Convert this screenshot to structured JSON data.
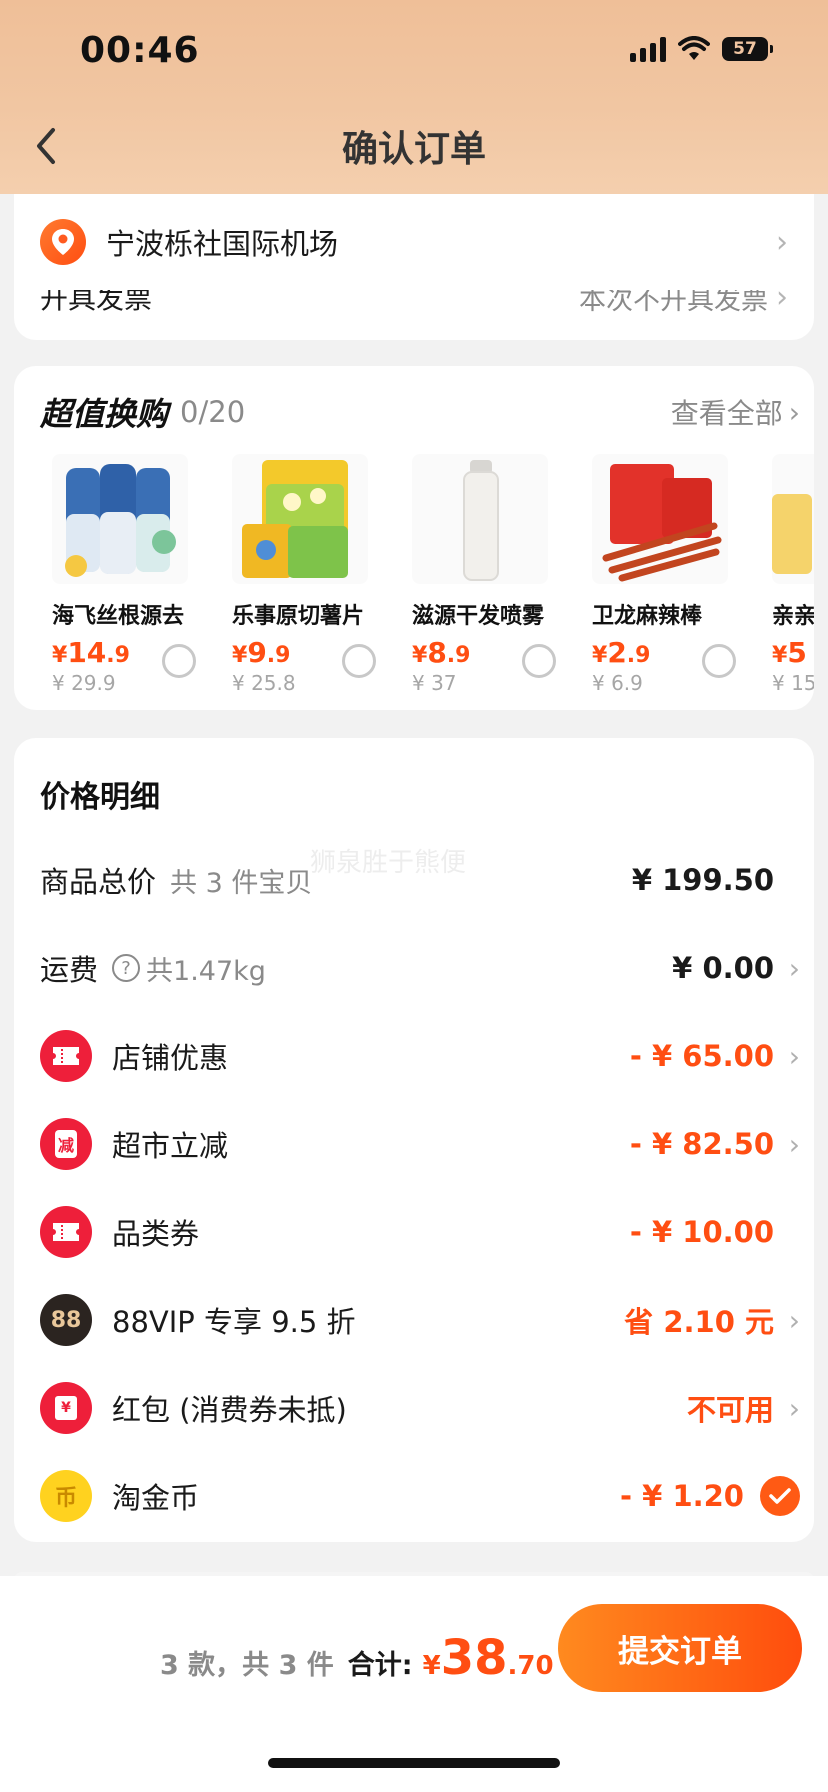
{
  "status_bar": {
    "time": "00:46",
    "battery": "57"
  },
  "header": {
    "title": "确认订单"
  },
  "address": {
    "text": "宁波栎社国际机场"
  },
  "invoice": {
    "label": "开具发票",
    "value": "本次不开具发票"
  },
  "deals": {
    "title": "超值换购",
    "count": "0/20",
    "more_label": "查看全部",
    "items": [
      {
        "name": "海飞丝根源去",
        "price_int": "14",
        "price_dec": ".9",
        "orig": "¥ 29.9"
      },
      {
        "name": "乐事原切薯片",
        "price_int": "9",
        "price_dec": ".9",
        "orig": "¥ 25.8"
      },
      {
        "name": "滋源干发喷雾",
        "price_int": "8",
        "price_dec": ".9",
        "orig": "¥ 37"
      },
      {
        "name": "卫龙麻辣棒",
        "price_int": "2",
        "price_dec": ".9",
        "orig": "¥ 6.9"
      },
      {
        "name": "亲亲",
        "price_int": "5",
        "price_dec": "",
        "orig": "¥ 15"
      }
    ],
    "currency": "¥"
  },
  "price_detail": {
    "title": "价格明细",
    "watermark": "狮泉胜于熊便",
    "rows": {
      "subtotal": {
        "label": "商品总价",
        "sub": "共 3 件宝贝",
        "value": "¥ 199.50"
      },
      "shipping": {
        "label": "运费",
        "sub": "共1.47kg",
        "value": "¥ 0.00"
      },
      "shop_discount": {
        "label": "店铺优惠",
        "value": "- ¥ 65.00"
      },
      "market_discount": {
        "label": "超市立减",
        "value": "- ¥ 82.50",
        "icon_text": "减"
      },
      "category_coupon": {
        "label": "品类券",
        "value": "- ¥ 10.00"
      },
      "vip": {
        "label": "88VIP 专享 9.5 折",
        "value": "省 2.10 元",
        "icon_text": "88"
      },
      "red_packet": {
        "label": "红包 (消费券未抵)",
        "value": "不可用",
        "icon_text": "¥"
      },
      "coins": {
        "label": "淘金币",
        "value": "- ¥ 1.20",
        "icon_text": "币"
      }
    }
  },
  "footer": {
    "count": "3 款，共 3 件",
    "total_label": "合计:",
    "currency": "¥",
    "total_int": "38",
    "total_dec": ".70",
    "submit_label": "提交订单"
  },
  "colors": {
    "accent": "#ff4e12",
    "header_bg": "#f1c6a2"
  }
}
